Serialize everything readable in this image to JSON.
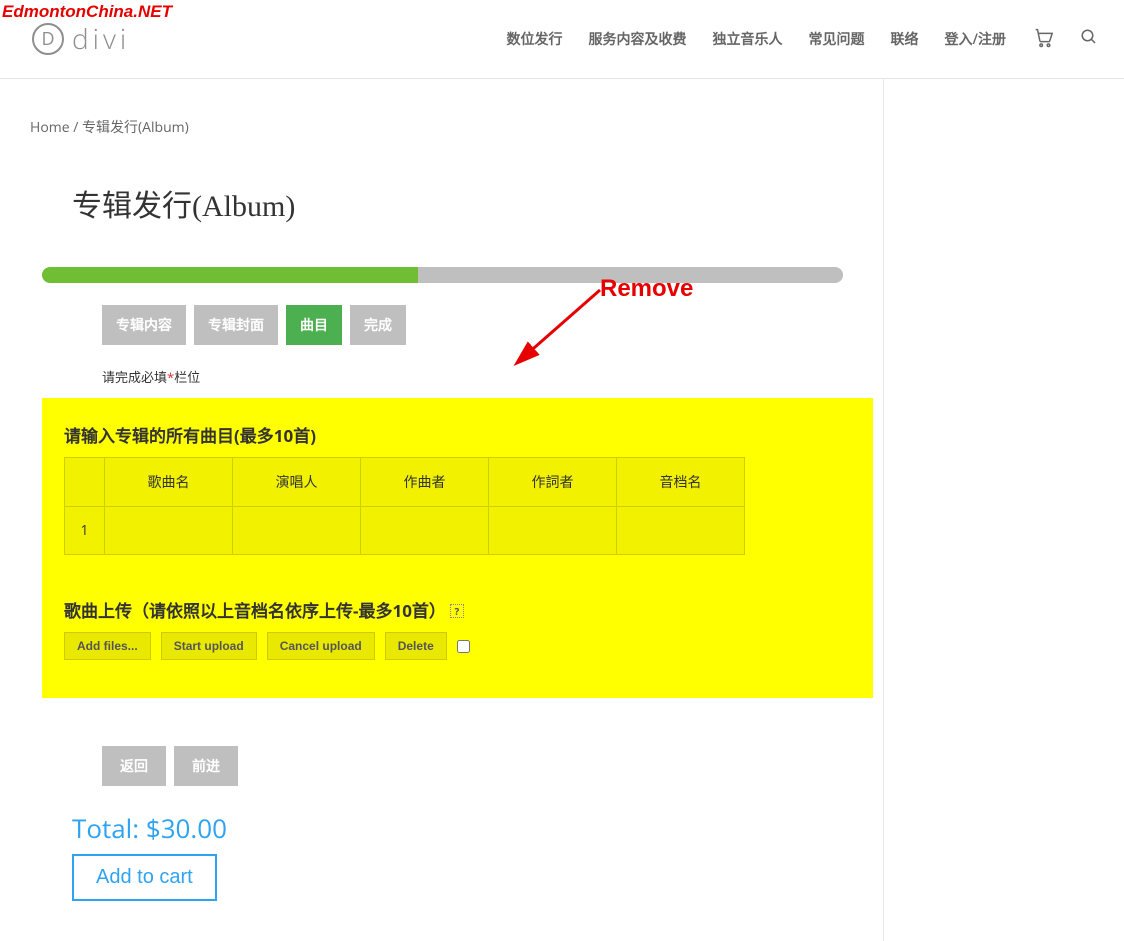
{
  "watermark": "EdmontonChina.NET",
  "logo": {
    "letter": "D",
    "name": "divi"
  },
  "nav": {
    "items": [
      "数位发行",
      "服务内容及收费",
      "独立音乐人",
      "常见问题",
      "联络",
      "登入/注册"
    ]
  },
  "breadcrumb": {
    "home": "Home",
    "sep": " / ",
    "current": "专辑发行(Album)"
  },
  "page_title": "专辑发行(Album)",
  "progress_percent": 47,
  "steps": {
    "items": [
      "专辑内容",
      "专辑封面",
      "曲目",
      "完成"
    ],
    "active_index": 2
  },
  "hint": {
    "pre": "请完成必填",
    "star": "*",
    "post": "栏位"
  },
  "tracks": {
    "heading": "请输入专辑的所有曲目(最多10首)",
    "columns": [
      "歌曲名",
      "演唱人",
      "作曲者",
      "作詞者",
      "音档名"
    ],
    "rows": [
      {
        "index": "1",
        "cells": [
          "",
          "",
          "",
          "",
          ""
        ]
      }
    ]
  },
  "upload": {
    "heading": "歌曲上传（请依照以上音档名依序上传-最多10首）",
    "help": "?",
    "buttons": [
      "Add files...",
      "Start upload",
      "Cancel upload",
      "Delete"
    ]
  },
  "navbuttons": {
    "back": "返回",
    "next": "前进"
  },
  "total": {
    "label": "Total: ",
    "value": "$30.00"
  },
  "add_to_cart": "Add to cart",
  "annotation": {
    "text": "Remove"
  }
}
